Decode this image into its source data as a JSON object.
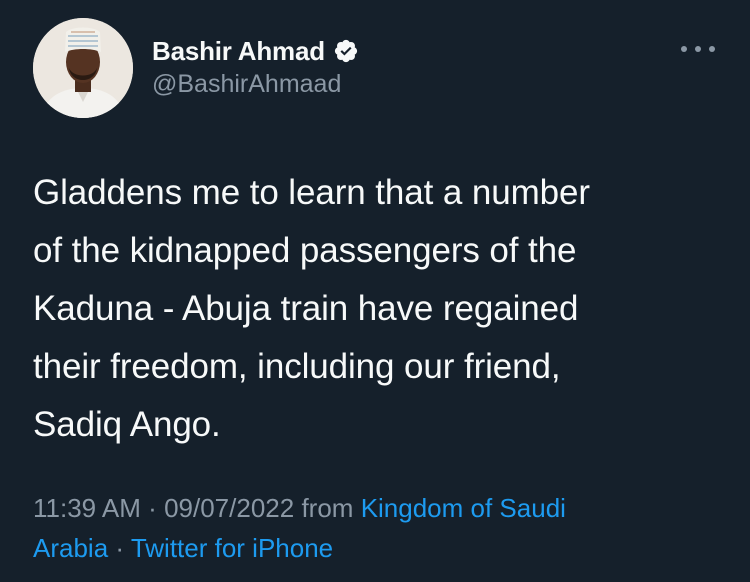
{
  "author": {
    "display_name": "Bashir Ahmad",
    "handle": "@BashirAhmaad",
    "verified": true
  },
  "tweet": {
    "text_lines": [
      "Gladdens me to learn that a number",
      "of the kidnapped passengers of the",
      "Kaduna - Abuja train have regained",
      "their freedom, including our friend,",
      "Sadiq Ango."
    ],
    "time": "11:39 AM",
    "separator": "·",
    "date": "09/07/2022",
    "from_label": "from",
    "location_line1": "Kingdom of Saudi",
    "location_line2": "Arabia",
    "source": "Twitter for iPhone"
  },
  "icons": {
    "verified": "verified-badge-icon",
    "more": "more-options-icon"
  },
  "colors": {
    "background": "#15202b",
    "text": "#f7f9f9",
    "secondary": "#8b98a5",
    "link": "#1d9bf0"
  }
}
